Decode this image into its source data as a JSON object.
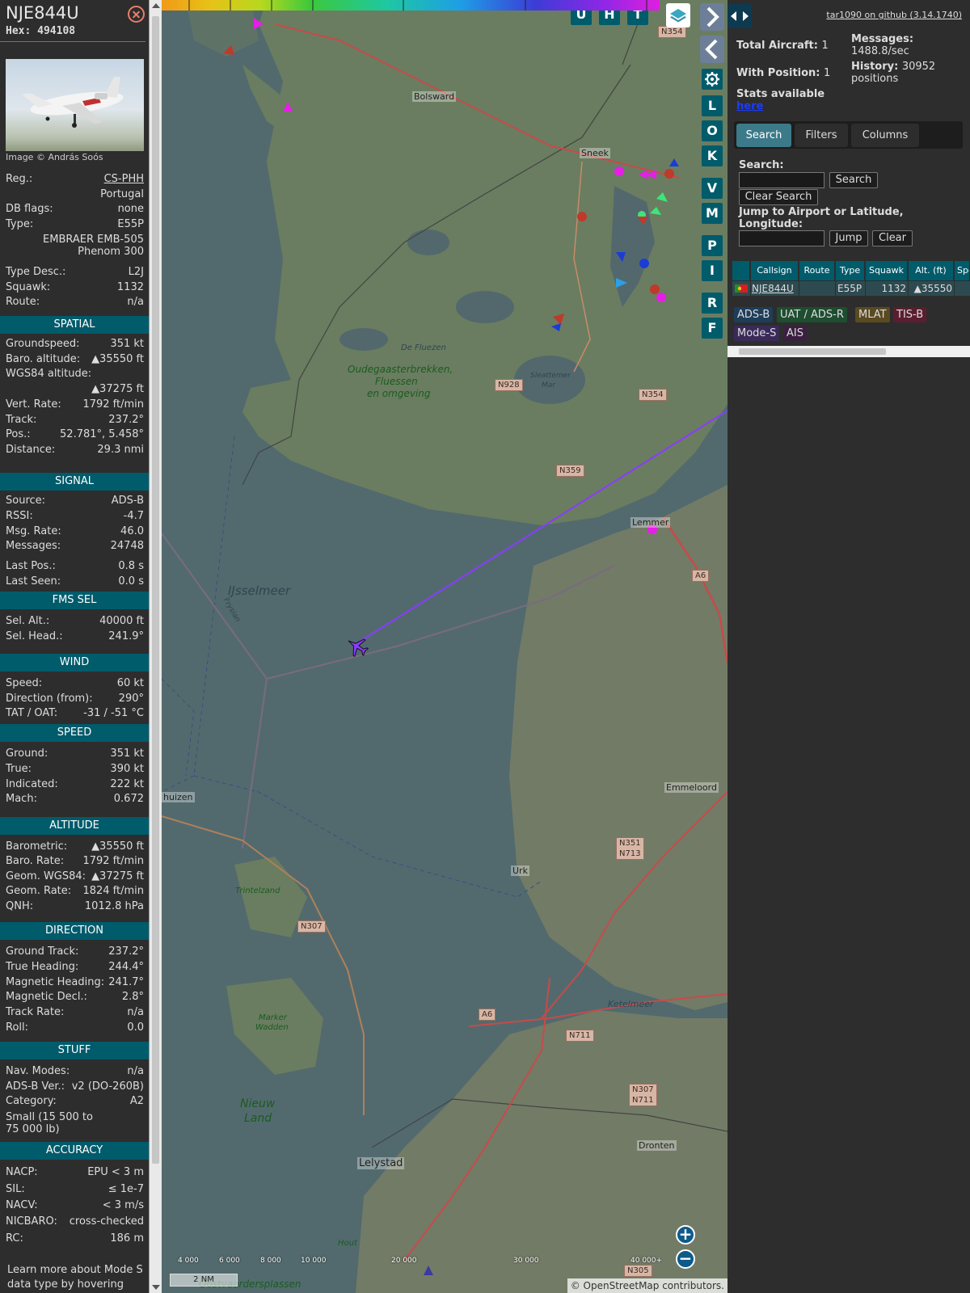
{
  "aircraft": {
    "callsign": "NJE844U",
    "hex": "Hex: 494108",
    "photo_credit": "Image © András Soós",
    "basic": [
      {
        "label": "Reg.:",
        "value": "CS-PHH"
      },
      {
        "label": "",
        "value": "Portugal"
      },
      {
        "label": "DB flags:",
        "value": "none"
      },
      {
        "label": "Type:",
        "value": "E55P"
      },
      {
        "label": "",
        "value": "EMBRAER EMB-505"
      },
      {
        "label": "",
        "value": "Phenom 300"
      },
      {
        "label": "Type Desc.:",
        "value": "L2J"
      },
      {
        "label": "Squawk:",
        "value": "1132"
      },
      {
        "label": "Route:",
        "value": "n/a"
      }
    ]
  },
  "sections": {
    "spatial": {
      "title": "SPATIAL",
      "rows": [
        {
          "label": "Groundspeed:",
          "value": "351 kt"
        },
        {
          "label": "Baro. altitude:",
          "value": "▲35550 ft"
        },
        {
          "label": "WGS84 altitude:",
          "value": ""
        },
        {
          "label": "",
          "value": "▲37275 ft"
        },
        {
          "label": "Vert. Rate:",
          "value": "1792 ft/min"
        },
        {
          "label": "Track:",
          "value": "237.2°"
        },
        {
          "label": "Pos.:",
          "value": "52.781°, 5.458°"
        },
        {
          "label": "Distance:",
          "value": "29.3 nmi"
        }
      ]
    },
    "signal": {
      "title": "SIGNAL",
      "rows": [
        {
          "label": "Source:",
          "value": "ADS-B"
        },
        {
          "label": "RSSI:",
          "value": "-4.7"
        },
        {
          "label": "Msg. Rate:",
          "value": "46.0"
        },
        {
          "label": "Messages:",
          "value": "24748"
        },
        {
          "label": "Last Pos.:",
          "value": "0.8 s"
        },
        {
          "label": "Last Seen:",
          "value": "0.0 s"
        }
      ]
    },
    "fms": {
      "title": "FMS SEL",
      "rows": [
        {
          "label": "Sel. Alt.:",
          "value": "40000 ft"
        },
        {
          "label": "Sel. Head.:",
          "value": "241.9°"
        }
      ]
    },
    "wind": {
      "title": "WIND",
      "rows": [
        {
          "label": "Speed:",
          "value": "60 kt"
        },
        {
          "label": "Direction (from):",
          "value": "290°"
        },
        {
          "label": "TAT / OAT:",
          "value": "-31 / -51 °C"
        }
      ]
    },
    "speed": {
      "title": "SPEED",
      "rows": [
        {
          "label": "Ground:",
          "value": "351 kt"
        },
        {
          "label": "True:",
          "value": "390 kt"
        },
        {
          "label": "Indicated:",
          "value": "222 kt"
        },
        {
          "label": "Mach:",
          "value": "0.672"
        }
      ]
    },
    "altitude": {
      "title": "ALTITUDE",
      "rows": [
        {
          "label": "Barometric:",
          "value": "▲35550 ft"
        },
        {
          "label": "Baro. Rate:",
          "value": "1792 ft/min"
        },
        {
          "label": "Geom. WGS84:",
          "value": "▲37275 ft"
        },
        {
          "label": "Geom. Rate:",
          "value": "1824 ft/min"
        },
        {
          "label": "QNH:",
          "value": "1012.8 hPa"
        }
      ]
    },
    "direction": {
      "title": "DIRECTION",
      "rows": [
        {
          "label": "Ground Track:",
          "value": "237.2°"
        },
        {
          "label": "True Heading:",
          "value": "244.4°"
        },
        {
          "label": "Magnetic Heading:",
          "value": "241.7°"
        },
        {
          "label": "Magnetic Decl.:",
          "value": "2.8°"
        },
        {
          "label": "Track Rate:",
          "value": "n/a"
        },
        {
          "label": "Roll:",
          "value": "0.0"
        }
      ]
    },
    "stuff": {
      "title": "STUFF",
      "rows": [
        {
          "label": "Nav. Modes:",
          "value": "n/a"
        },
        {
          "label": "ADS-B Ver.:",
          "value": "v2 (DO-260B)"
        },
        {
          "label": "Category:",
          "value": "A2"
        }
      ],
      "category_desc_1": "Small (15 500 to",
      "category_desc_2": "75 000 lb)"
    },
    "accuracy": {
      "title": "ACCURACY",
      "rows": [
        {
          "label": "NACP:",
          "value": "EPU < 3 m"
        },
        {
          "label": "SIL:",
          "value": "≤ 1e-7"
        },
        {
          "label": "NACV:",
          "value": "< 3 m/s"
        },
        {
          "label": "NICBARO:",
          "value": "cross-checked"
        },
        {
          "label": "RC:",
          "value": "186 m"
        }
      ],
      "footer_1": "Learn more about Mode S",
      "footer_2": "data type by hovering over"
    }
  },
  "map": {
    "top_buttons": [
      "U",
      "H",
      "T"
    ],
    "side_buttons": [
      "L",
      "O",
      "K",
      "V",
      "M",
      "P",
      "I",
      "R",
      "F"
    ],
    "zoom_in": "+",
    "zoom_out": "−",
    "scale": "2 NM",
    "attribution": "© OpenStreetMap contributors.",
    "alt_labels": [
      "4 000",
      "6 000",
      "8 000",
      "10 000",
      "20 000",
      "30 000",
      "40 000+"
    ],
    "places": {
      "bolsward": "Bolsward",
      "sneek": "Sneek",
      "lemmer": "Lemmer",
      "emmeloord": "Emmeloord",
      "urk": "Urk",
      "dronten": "Dronten",
      "lelystad": "Lelystad",
      "huizen": "huizen",
      "ijsselmeer": "IJsselmeer",
      "ketelmeer": "Ketelmeer",
      "fluezen": "De Fluezen",
      "oudega1": "Oudegaasterbrekken,",
      "oudega2": "Fluessen",
      "oudega3": "en omgeving",
      "slotermeer1": "Sleattemer",
      "slotermeer2": "Mar",
      "nieuwland1": "Nieuw",
      "nieuwland2": "Land",
      "trintelzand": "Trintelzand",
      "marker1": "Marker",
      "marker2": "Wadden",
      "friesian": "Frysian",
      "oostvaarders": "Oostvaardersplassen",
      "hout": "Hout"
    },
    "roads": {
      "n354a": "N354",
      "n928": "N928",
      "n354b": "N354",
      "n359": "N359",
      "a6a": "A6",
      "n351": "N351\nN713",
      "n307a": "N307",
      "a6b": "A6",
      "n711": "N711",
      "n307b": "N307\nN711",
      "n305": "N305"
    }
  },
  "sidebar": {
    "version": "tar1090 on github (3.14.1740)",
    "total_label": "Total Aircraft:",
    "total_value": "1",
    "position_label": "With Position:",
    "position_value": "1",
    "messages_label": "Messages:",
    "messages_value": "1488.8/sec",
    "history_label": "History:",
    "history_value": "30952",
    "history_unit": "positions",
    "stats_label": "Stats available",
    "stats_link": "here",
    "tabs": [
      "Search",
      "Filters",
      "Columns"
    ],
    "search_label": "Search:",
    "search_button": "Search",
    "clear_search_button": "Clear Search",
    "jump_label_1": "Jump to Airport or Latitude,",
    "jump_label_2": "Longitude:",
    "jump_button": "Jump",
    "clear_button": "Clear",
    "table": {
      "headers": [
        "Callsign",
        "Route",
        "Type",
        "Squawk",
        "Alt. (ft)",
        "Spd"
      ],
      "row": {
        "callsign": "NJE844U",
        "route": "",
        "type": "E55P",
        "squawk": "1132",
        "alt": "▲35550"
      }
    },
    "source_chips": [
      "ADS-B",
      "UAT / ADS-R",
      "MLAT",
      "TIS-B",
      "Mode-S",
      "AIS"
    ]
  },
  "colors": {
    "header_teal": "#005b6b",
    "trail": "#8a3cff",
    "chip_adsb": "#1e3d5a",
    "chip_uat": "#1e4d30",
    "chip_mlat": "#5a4a20",
    "chip_tisb": "#5a1e30",
    "chip_modes": "#3a2a5a",
    "chip_ais": "#3a2040"
  }
}
